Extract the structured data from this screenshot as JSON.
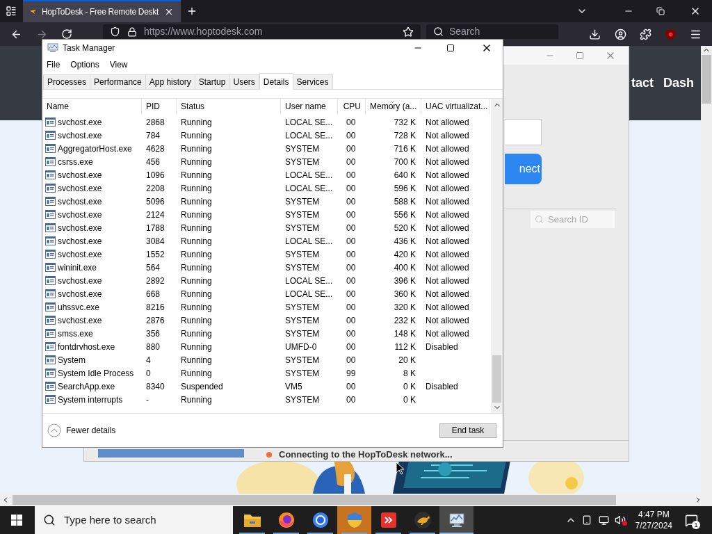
{
  "browser": {
    "tab_title": "HopToDesk - Free Remote Deskt",
    "url": "https://www.hoptodesk.com",
    "search_placeholder": "Search",
    "page_nav": [
      "tact",
      "Dash"
    ]
  },
  "hoptodesk": {
    "connect_button": "nect",
    "search_placeholder": "Search ID",
    "status": "Connecting to the HopToDesk network..."
  },
  "task_manager": {
    "title": "Task Manager",
    "menu": [
      "File",
      "Options",
      "View"
    ],
    "tabs": [
      {
        "label": "Processes",
        "selected": false
      },
      {
        "label": "Performance",
        "selected": false
      },
      {
        "label": "App history",
        "selected": false
      },
      {
        "label": "Startup",
        "selected": false
      },
      {
        "label": "Users",
        "selected": false
      },
      {
        "label": "Details",
        "selected": true
      },
      {
        "label": "Services",
        "selected": false
      }
    ],
    "columns": [
      {
        "label": "Name",
        "sorted": false
      },
      {
        "label": "PID",
        "sorted": false
      },
      {
        "label": "Status",
        "sorted": false
      },
      {
        "label": "User name",
        "sorted": false
      },
      {
        "label": "CPU",
        "sorted": false
      },
      {
        "label": "Memory (a...",
        "sorted": true
      },
      {
        "label": "UAC virtualizat...",
        "sorted": false
      }
    ],
    "rows": [
      {
        "name": "svchost.exe",
        "pid": "2868",
        "status": "Running",
        "user": "LOCAL SE...",
        "cpu": "00",
        "memory": "732 K",
        "uac": "Not allowed"
      },
      {
        "name": "svchost.exe",
        "pid": "784",
        "status": "Running",
        "user": "LOCAL SE...",
        "cpu": "00",
        "memory": "728 K",
        "uac": "Not allowed"
      },
      {
        "name": "AggregatorHost.exe",
        "pid": "4628",
        "status": "Running",
        "user": "SYSTEM",
        "cpu": "00",
        "memory": "716 K",
        "uac": "Not allowed"
      },
      {
        "name": "csrss.exe",
        "pid": "456",
        "status": "Running",
        "user": "SYSTEM",
        "cpu": "00",
        "memory": "700 K",
        "uac": "Not allowed"
      },
      {
        "name": "svchost.exe",
        "pid": "1096",
        "status": "Running",
        "user": "LOCAL SE...",
        "cpu": "00",
        "memory": "640 K",
        "uac": "Not allowed"
      },
      {
        "name": "svchost.exe",
        "pid": "2208",
        "status": "Running",
        "user": "LOCAL SE...",
        "cpu": "00",
        "memory": "596 K",
        "uac": "Not allowed"
      },
      {
        "name": "svchost.exe",
        "pid": "5096",
        "status": "Running",
        "user": "SYSTEM",
        "cpu": "00",
        "memory": "588 K",
        "uac": "Not allowed"
      },
      {
        "name": "svchost.exe",
        "pid": "2124",
        "status": "Running",
        "user": "SYSTEM",
        "cpu": "00",
        "memory": "556 K",
        "uac": "Not allowed"
      },
      {
        "name": "svchost.exe",
        "pid": "1788",
        "status": "Running",
        "user": "SYSTEM",
        "cpu": "00",
        "memory": "520 K",
        "uac": "Not allowed"
      },
      {
        "name": "svchost.exe",
        "pid": "3084",
        "status": "Running",
        "user": "LOCAL SE...",
        "cpu": "00",
        "memory": "436 K",
        "uac": "Not allowed"
      },
      {
        "name": "svchost.exe",
        "pid": "1552",
        "status": "Running",
        "user": "SYSTEM",
        "cpu": "00",
        "memory": "420 K",
        "uac": "Not allowed"
      },
      {
        "name": "wininit.exe",
        "pid": "564",
        "status": "Running",
        "user": "SYSTEM",
        "cpu": "00",
        "memory": "400 K",
        "uac": "Not allowed"
      },
      {
        "name": "svchost.exe",
        "pid": "2892",
        "status": "Running",
        "user": "LOCAL SE...",
        "cpu": "00",
        "memory": "396 K",
        "uac": "Not allowed"
      },
      {
        "name": "svchost.exe",
        "pid": "668",
        "status": "Running",
        "user": "LOCAL SE...",
        "cpu": "00",
        "memory": "360 K",
        "uac": "Not allowed"
      },
      {
        "name": "uhssvc.exe",
        "pid": "8216",
        "status": "Running",
        "user": "SYSTEM",
        "cpu": "00",
        "memory": "320 K",
        "uac": "Not allowed"
      },
      {
        "name": "svchost.exe",
        "pid": "2876",
        "status": "Running",
        "user": "SYSTEM",
        "cpu": "00",
        "memory": "232 K",
        "uac": "Not allowed"
      },
      {
        "name": "smss.exe",
        "pid": "356",
        "status": "Running",
        "user": "SYSTEM",
        "cpu": "00",
        "memory": "148 K",
        "uac": "Not allowed"
      },
      {
        "name": "fontdrvhost.exe",
        "pid": "880",
        "status": "Running",
        "user": "UMFD-0",
        "cpu": "00",
        "memory": "112 K",
        "uac": "Disabled"
      },
      {
        "name": "System",
        "pid": "4",
        "status": "Running",
        "user": "SYSTEM",
        "cpu": "00",
        "memory": "20 K"
      },
      {
        "name": "System Idle Process",
        "pid": "0",
        "status": "Running",
        "user": "SYSTEM",
        "cpu": "99",
        "memory": "8 K"
      },
      {
        "name": "SearchApp.exe",
        "pid": "8340",
        "status": "Suspended",
        "user": "VM5",
        "cpu": "00",
        "memory": "0 K",
        "uac": "Disabled"
      },
      {
        "name": "System interrupts",
        "pid": "-",
        "status": "Running",
        "user": "SYSTEM",
        "cpu": "00",
        "memory": "0 K"
      }
    ],
    "fewer_details": "Fewer details",
    "end_task": "End task"
  },
  "taskbar": {
    "search_placeholder": "Type here to search",
    "apps": [
      {
        "kind": "folder",
        "selected": false,
        "flashing": false
      },
      {
        "kind": "firefox",
        "selected": false,
        "flashing": false
      },
      {
        "kind": "chrome",
        "selected": false,
        "flashing": false
      },
      {
        "kind": "shield",
        "selected": false,
        "flashing": true
      },
      {
        "kind": "remote",
        "selected": false,
        "flashing": false
      },
      {
        "kind": "kangaroo",
        "selected": false,
        "flashing": false
      },
      {
        "kind": "taskmgr",
        "selected": true,
        "flashing": false
      }
    ],
    "time": "4:47 PM",
    "date": "7/27/2024",
    "notifications": "1"
  }
}
